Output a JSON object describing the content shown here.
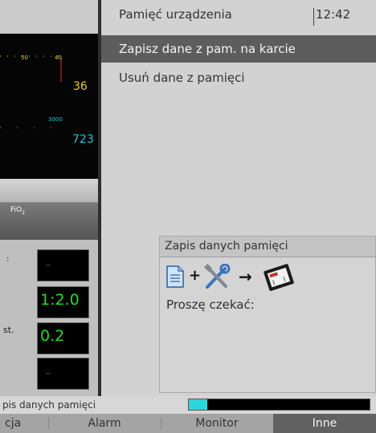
{
  "header": {
    "title": "Pamięć urządzenia",
    "time": "12:42"
  },
  "menu": {
    "items": [
      {
        "label": "Zapisz dane z pam. na karcie",
        "selected": true
      },
      {
        "label": "Usuń dane z pamięci",
        "selected": false
      }
    ]
  },
  "left_panel": {
    "wave": {
      "tick_a": "50",
      "tick_b": "40",
      "value_1": "36",
      "tick_c": "3000",
      "value_2": "723"
    },
    "fio2_label": "FiO",
    "fio2_sub": "2",
    "values": {
      "box_1": "--",
      "box_2": "1:2.0",
      "box_3": "0.2",
      "box_4": "--"
    },
    "side_label_1": ":",
    "side_label_2": "st."
  },
  "popup": {
    "title": "Zapis danych pamięci",
    "plus": "+",
    "arrow": "→",
    "message": "Proszę czekać:"
  },
  "status": {
    "text": "pis danych pamięci",
    "progress": 0.1
  },
  "tabs": [
    {
      "label": "cja",
      "active": false
    },
    {
      "label": "Alarm",
      "active": false
    },
    {
      "label": "Monitor",
      "active": false
    },
    {
      "label": "Inne",
      "active": true
    }
  ],
  "colors": {
    "accent_selected": "#5d5d5d",
    "progress": "#2ed4dc",
    "numeric_green": "#22dd22",
    "wave_yellow": "#f0d020",
    "wave_cyan": "#18c7d1"
  },
  "icons": [
    "document-icon",
    "tools-icon",
    "arrow-right-icon",
    "memory-card-icon"
  ]
}
